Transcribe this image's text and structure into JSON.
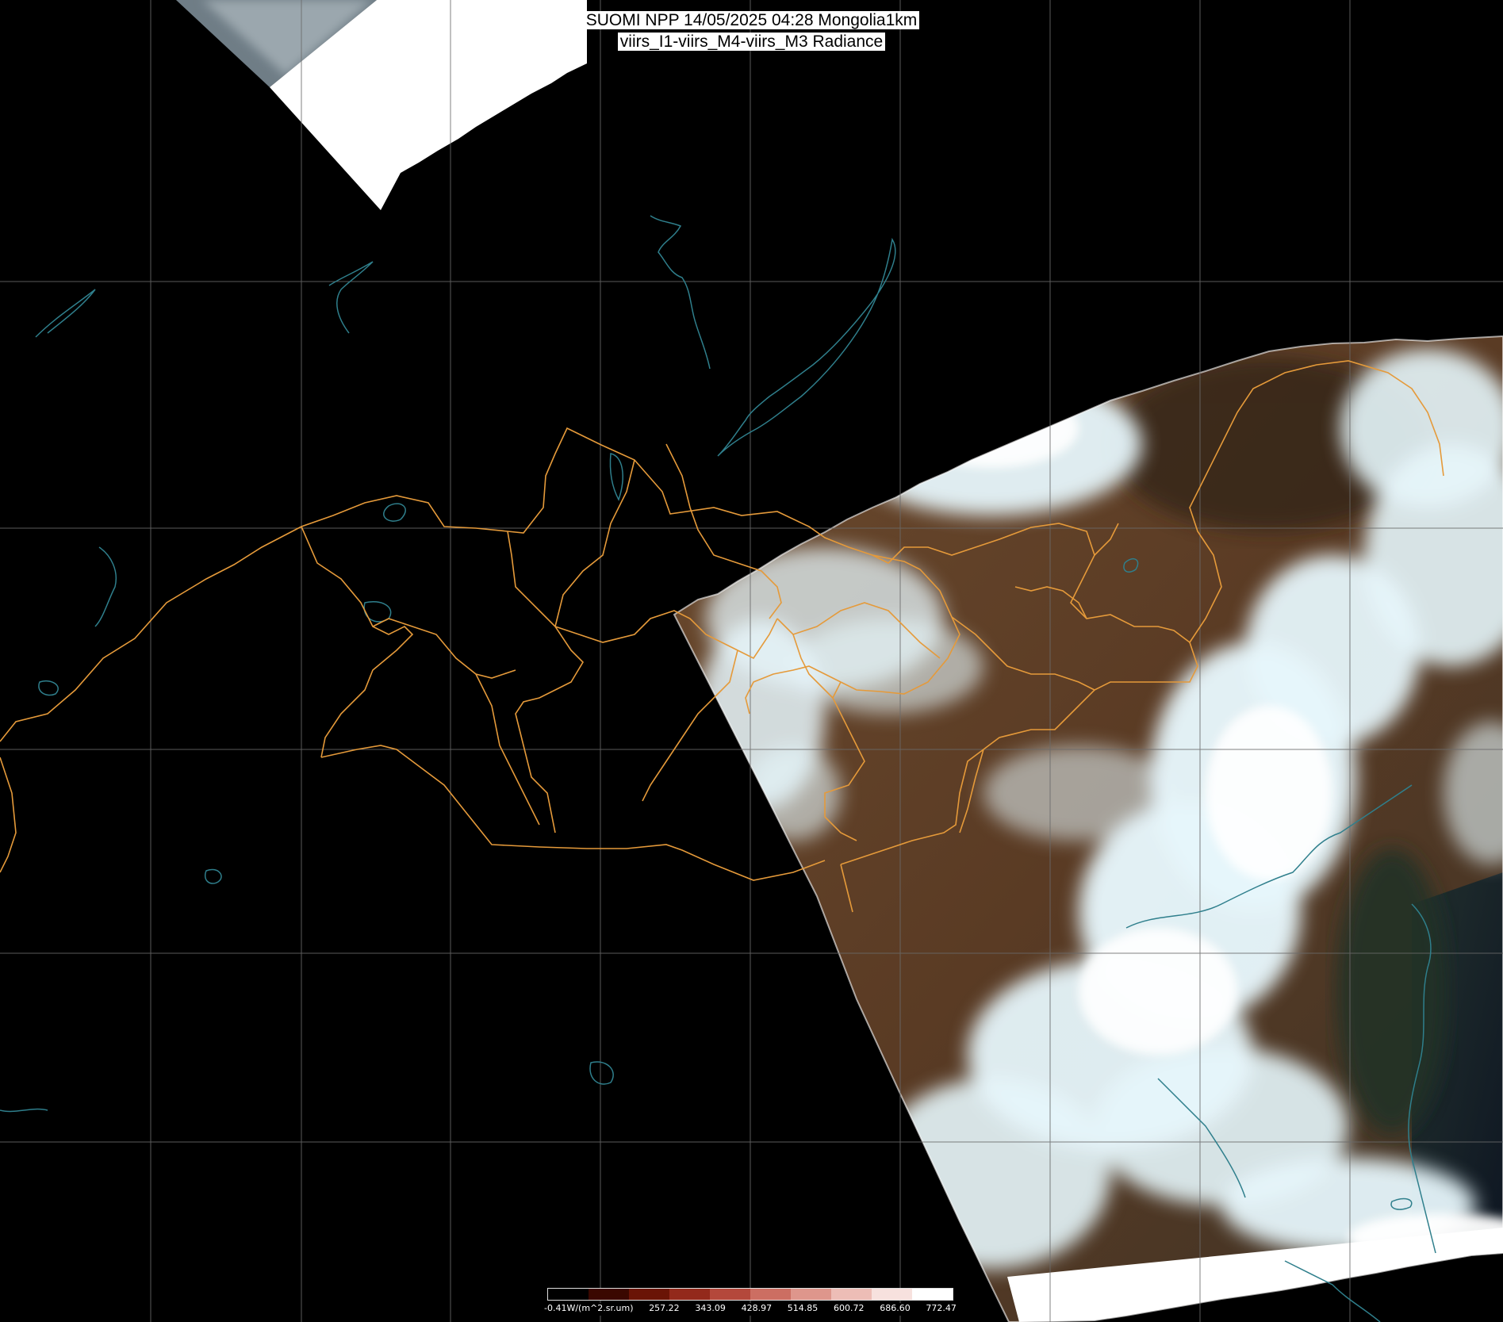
{
  "title": {
    "line1": "SUOMI NPP 14/05/2025 04:28 Mongolia1km",
    "line2": "viirs_I1-viirs_M4-viirs_M3 Radiance"
  },
  "colorbar": {
    "labels": [
      "-0.41W/(m^2.sr.um)",
      "257.22",
      "343.09",
      "428.97",
      "514.85",
      "600.72",
      "686.60",
      "772.47"
    ],
    "colors": [
      "#000000",
      "#3a0800",
      "#6a1406",
      "#93291b",
      "#b4483b",
      "#cc6e62",
      "#de968c",
      "#edbdb6",
      "#f7e1de",
      "#ffffff"
    ]
  },
  "map": {
    "background_color": "#000000",
    "graticule_color": "#6a6a6a",
    "admin_border_color": "#e59a3a",
    "water_outline_color": "#2f7f8c",
    "swath_land_color": "#5a3b24",
    "cloud_color": "#e6f6fb"
  }
}
